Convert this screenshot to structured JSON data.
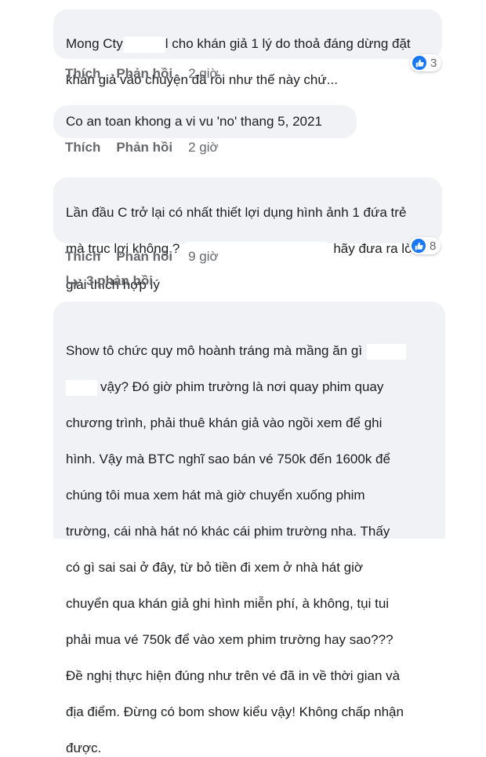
{
  "comments": [
    {
      "text_a": "Mong Cty",
      "text_b": "l cho khán giả 1 lý do thoả đáng dừng đặt",
      "text_c": "khán giả vào chuyện đã rồi như thế này chứ...",
      "like": "Thích",
      "reply": "Phản hồi",
      "time": "2 giờ",
      "reaction_count": "3"
    },
    {
      "text": "Co an toan khong a vi vu 'no' thang 5, 2021",
      "like": "Thích",
      "reply": "Phản hồi",
      "time": "2 giờ"
    },
    {
      "text_a": "Lần đầu C trở lại có nhất thiết lợi dụng hình ảnh 1 đứa trẻ",
      "text_b": "mà trục lợi không ?",
      "text_c": "hãy đưa ra lời",
      "text_d": "giải thích hợp lý",
      "like": "Thích",
      "reply": "Phản hồi",
      "time": "9 giờ",
      "reaction_count": "8",
      "replies_label": "3 phản hồi"
    },
    {
      "line1": "Show tô chức quy mô hoành tráng mà mầng ăn gì",
      "line2": "vậy? Đó giờ phim trường là nơi quay phim quay",
      "line3": "chương trình, phải thuê khán giả vào ngồi xem để ghi",
      "line4": "hình. Vậy mà BTC nghĩ sao bán vé 750k đến 1600k để",
      "line5": "chúng tôi mua xem hát mà giờ chuyển xuống phim",
      "line6": "trường, cái nhà hát nó khác cái phim trường nha. Thấy",
      "line7": "có gì sai sai ở đây, từ bỏ tiền đi xem ở nhà hát giờ",
      "line8": "chuyển qua khán giả ghi hình miễn phí, à không, tụi tui",
      "line9": "phải mua vé 750k để vào xem phim trường hay sao???",
      "line10": "Đề nghị thực hiện đúng như trên vé đã in về thời gian và",
      "line11": "địa điểm. Đừng có bom show kiểu vậy! Không chấp nhận",
      "line12": "được."
    }
  ],
  "colors": {
    "bubble": "#f0f2f5",
    "like_blue": "#1877f2",
    "meta_gray": "#65676b"
  },
  "icons": {
    "reaction": "thumbs-up-icon",
    "reply_arrow": "reply-arrow-icon"
  }
}
